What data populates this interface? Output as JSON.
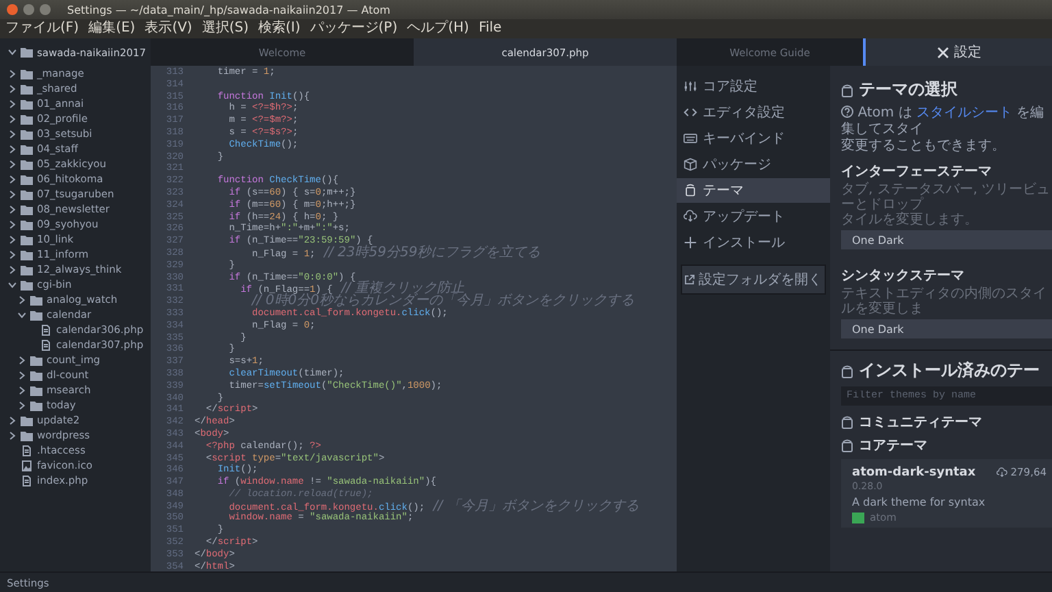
{
  "window": {
    "title": "Settings — ~/data_main/_hp/sawada-naikaiin2017 — Atom"
  },
  "menu": [
    "ファイル(F)",
    "編集(E)",
    "表示(V)",
    "選択(S)",
    "検索(I)",
    "パッケージ(P)",
    "ヘルプ(H)",
    "File"
  ],
  "sidebar": {
    "tree": {
      "name": "sawada-naikaiin2017",
      "kind": "folder",
      "expanded": true,
      "children": [
        {
          "name": "_manage",
          "kind": "folder",
          "expanded": false
        },
        {
          "name": "_shared",
          "kind": "folder",
          "expanded": false
        },
        {
          "name": "01_annai",
          "kind": "folder",
          "expanded": false
        },
        {
          "name": "02_profile",
          "kind": "folder",
          "expanded": false
        },
        {
          "name": "03_setsubi",
          "kind": "folder",
          "expanded": false
        },
        {
          "name": "04_staff",
          "kind": "folder",
          "expanded": false
        },
        {
          "name": "05_zakkicyou",
          "kind": "folder",
          "expanded": false
        },
        {
          "name": "06_hitokoma",
          "kind": "folder",
          "expanded": false
        },
        {
          "name": "07_tsugaruben",
          "kind": "folder",
          "expanded": false
        },
        {
          "name": "08_newsletter",
          "kind": "folder",
          "expanded": false
        },
        {
          "name": "09_syohyou",
          "kind": "folder",
          "expanded": false
        },
        {
          "name": "10_link",
          "kind": "folder",
          "expanded": false
        },
        {
          "name": "11_inform",
          "kind": "folder",
          "expanded": false
        },
        {
          "name": "12_always_think",
          "kind": "folder",
          "expanded": false
        },
        {
          "name": "cgi-bin",
          "kind": "folder",
          "expanded": true,
          "children": [
            {
              "name": "analog_watch",
              "kind": "folder",
              "expanded": false
            },
            {
              "name": "calendar",
              "kind": "folder",
              "expanded": true,
              "children": [
                {
                  "name": "calendar306.php",
                  "kind": "file"
                },
                {
                  "name": "calendar307.php",
                  "kind": "file"
                }
              ]
            },
            {
              "name": "count_img",
              "kind": "folder",
              "expanded": false
            },
            {
              "name": "dl-count",
              "kind": "folder",
              "expanded": false
            },
            {
              "name": "msearch",
              "kind": "folder",
              "expanded": false
            },
            {
              "name": "today",
              "kind": "folder",
              "expanded": false
            }
          ]
        },
        {
          "name": "update2",
          "kind": "folder",
          "expanded": false
        },
        {
          "name": "wordpress",
          "kind": "folder",
          "expanded": false
        },
        {
          "name": ".htaccess",
          "kind": "file"
        },
        {
          "name": "favicon.ico",
          "kind": "image"
        },
        {
          "name": "index.php",
          "kind": "file"
        }
      ]
    }
  },
  "editor_tabs": [
    {
      "label": "Welcome",
      "selected": false
    },
    {
      "label": "calendar307.php",
      "selected": true
    }
  ],
  "code": [
    {
      "number": "313",
      "tokens": [
        {
          "kind": "plain",
          "text": "    timer = "
        },
        {
          "kind": "number",
          "text": "1"
        },
        {
          "kind": "plain",
          "text": ";"
        }
      ]
    },
    {
      "number": "314"
    },
    {
      "number": "315",
      "tokens": [
        {
          "kind": "keyword",
          "text": "    function"
        },
        {
          "kind": "function",
          "text": " Init"
        },
        {
          "kind": "plain",
          "text": "(){"
        }
      ]
    },
    {
      "number": "316",
      "tokens": [
        {
          "kind": "plain",
          "text": "      h = "
        },
        {
          "kind": "php",
          "text": "<?=$h?>"
        },
        {
          "kind": "plain",
          "text": ";"
        }
      ]
    },
    {
      "number": "317",
      "tokens": [
        {
          "kind": "plain",
          "text": "      m = "
        },
        {
          "kind": "php",
          "text": "<?=$m?>"
        },
        {
          "kind": "plain",
          "text": ";"
        }
      ]
    },
    {
      "number": "318",
      "tokens": [
        {
          "kind": "plain",
          "text": "      s = "
        },
        {
          "kind": "php",
          "text": "<?=$s?>"
        },
        {
          "kind": "plain",
          "text": ";"
        }
      ]
    },
    {
      "number": "319",
      "tokens": [
        {
          "kind": "function",
          "text": "      CheckTime"
        },
        {
          "kind": "plain",
          "text": "();"
        }
      ]
    },
    {
      "number": "320",
      "tokens": [
        {
          "kind": "plain",
          "text": "    }"
        }
      ]
    },
    {
      "number": "321"
    },
    {
      "number": "322",
      "tokens": [
        {
          "kind": "keyword",
          "text": "    function"
        },
        {
          "kind": "function",
          "text": " CheckTime"
        },
        {
          "kind": "plain",
          "text": "(){"
        }
      ]
    },
    {
      "number": "323",
      "tokens": [
        {
          "kind": "keyword",
          "text": "      if"
        },
        {
          "kind": "plain",
          "text": " (s=="
        },
        {
          "kind": "number",
          "text": "60"
        },
        {
          "kind": "plain",
          "text": ") { s="
        },
        {
          "kind": "number",
          "text": "0"
        },
        {
          "kind": "plain",
          "text": ";m++;}"
        }
      ]
    },
    {
      "number": "324",
      "tokens": [
        {
          "kind": "keyword",
          "text": "      if"
        },
        {
          "kind": "plain",
          "text": " (m=="
        },
        {
          "kind": "number",
          "text": "60"
        },
        {
          "kind": "plain",
          "text": ") { m="
        },
        {
          "kind": "number",
          "text": "0"
        },
        {
          "kind": "plain",
          "text": ";h++;}"
        }
      ]
    },
    {
      "number": "325",
      "tokens": [
        {
          "kind": "keyword",
          "text": "      if"
        },
        {
          "kind": "plain",
          "text": " (h=="
        },
        {
          "kind": "number",
          "text": "24"
        },
        {
          "kind": "plain",
          "text": ") { h="
        },
        {
          "kind": "number",
          "text": "0"
        },
        {
          "kind": "plain",
          "text": "; }"
        }
      ]
    },
    {
      "number": "326",
      "tokens": [
        {
          "kind": "plain",
          "text": "      n_Time=h+"
        },
        {
          "kind": "string",
          "text": "\":\""
        },
        {
          "kind": "plain",
          "text": "+m+"
        },
        {
          "kind": "string",
          "text": "\":\""
        },
        {
          "kind": "plain",
          "text": "+s;"
        }
      ]
    },
    {
      "number": "327",
      "tokens": [
        {
          "kind": "keyword",
          "text": "      if"
        },
        {
          "kind": "plain",
          "text": " (n_Time=="
        },
        {
          "kind": "string",
          "text": "\"23:59:59\""
        },
        {
          "kind": "plain",
          "text": ") {"
        }
      ]
    },
    {
      "number": "328",
      "tokens": [
        {
          "kind": "plain",
          "text": "          n_Flag = "
        },
        {
          "kind": "number",
          "text": "1"
        },
        {
          "kind": "plain",
          "text": ";"
        },
        {
          "kind": "comment",
          "text": "  // 23時59分59秒にフラグを立てる"
        }
      ]
    },
    {
      "number": "329",
      "tokens": [
        {
          "kind": "plain",
          "text": "      }"
        }
      ]
    },
    {
      "number": "330",
      "tokens": [
        {
          "kind": "keyword",
          "text": "      if"
        },
        {
          "kind": "plain",
          "text": " (n_Time=="
        },
        {
          "kind": "string",
          "text": "\"0:0:0\""
        },
        {
          "kind": "plain",
          "text": ") {"
        }
      ]
    },
    {
      "number": "331",
      "tokens": [
        {
          "kind": "keyword",
          "text": "        if"
        },
        {
          "kind": "plain",
          "text": " (n_Flag=="
        },
        {
          "kind": "number",
          "text": "1"
        },
        {
          "kind": "plain",
          "text": ") {"
        },
        {
          "kind": "comment",
          "text": "  // 重複クリック防止"
        }
      ]
    },
    {
      "number": "332",
      "tokens": [
        {
          "kind": "comment",
          "text": "          // 0時0分0秒ならカレンダーの「今月」ボタンをクリックする"
        }
      ]
    },
    {
      "number": "333",
      "tokens": [
        {
          "kind": "variable",
          "text": "          document.cal_form.kongetu."
        },
        {
          "kind": "function",
          "text": "click"
        },
        {
          "kind": "plain",
          "text": "();"
        }
      ]
    },
    {
      "number": "334",
      "tokens": [
        {
          "kind": "plain",
          "text": "          n_Flag = "
        },
        {
          "kind": "number",
          "text": "0"
        },
        {
          "kind": "plain",
          "text": ";"
        }
      ]
    },
    {
      "number": "335",
      "tokens": [
        {
          "kind": "plain",
          "text": "        }"
        }
      ]
    },
    {
      "number": "336",
      "tokens": [
        {
          "kind": "plain",
          "text": "      }"
        }
      ]
    },
    {
      "number": "337",
      "tokens": [
        {
          "kind": "plain",
          "text": "      s=s+"
        },
        {
          "kind": "number",
          "text": "1"
        },
        {
          "kind": "plain",
          "text": ";"
        }
      ]
    },
    {
      "number": "338",
      "tokens": [
        {
          "kind": "function",
          "text": "      clearTimeout"
        },
        {
          "kind": "plain",
          "text": "(timer);"
        }
      ]
    },
    {
      "number": "339",
      "tokens": [
        {
          "kind": "plain",
          "text": "      timer="
        },
        {
          "kind": "function",
          "text": "setTimeout"
        },
        {
          "kind": "plain",
          "text": "("
        },
        {
          "kind": "string",
          "text": "\"CheckTime()\""
        },
        {
          "kind": "plain",
          "text": ","
        },
        {
          "kind": "number",
          "text": "1000"
        },
        {
          "kind": "plain",
          "text": ");"
        }
      ]
    },
    {
      "number": "340",
      "tokens": [
        {
          "kind": "plain",
          "text": "    }"
        }
      ]
    },
    {
      "number": "341",
      "tokens": [
        {
          "kind": "plain",
          "text": "  </"
        },
        {
          "kind": "tag",
          "text": "script"
        },
        {
          "kind": "plain",
          "text": ">"
        }
      ]
    },
    {
      "number": "342",
      "tokens": [
        {
          "kind": "plain",
          "text": "</"
        },
        {
          "kind": "tag",
          "text": "head"
        },
        {
          "kind": "plain",
          "text": ">"
        }
      ]
    },
    {
      "number": "343",
      "tokens": [
        {
          "kind": "plain",
          "text": "<"
        },
        {
          "kind": "tag",
          "text": "body"
        },
        {
          "kind": "plain",
          "text": ">"
        }
      ]
    },
    {
      "number": "344",
      "tokens": [
        {
          "kind": "php",
          "text": "  <?php"
        },
        {
          "kind": "plain",
          "text": " calendar(); "
        },
        {
          "kind": "php",
          "text": "?>"
        }
      ]
    },
    {
      "number": "345",
      "tokens": [
        {
          "kind": "plain",
          "text": "  <"
        },
        {
          "kind": "tag",
          "text": "script"
        },
        {
          "kind": "attr",
          "text": " type"
        },
        {
          "kind": "plain",
          "text": "="
        },
        {
          "kind": "string",
          "text": "\"text/javascript\""
        },
        {
          "kind": "plain",
          "text": ">"
        }
      ]
    },
    {
      "number": "346",
      "tokens": [
        {
          "kind": "function",
          "text": "    Init"
        },
        {
          "kind": "plain",
          "text": "();"
        }
      ]
    },
    {
      "number": "347",
      "tokens": [
        {
          "kind": "keyword",
          "text": "    if"
        },
        {
          "kind": "plain",
          "text": " ("
        },
        {
          "kind": "variable",
          "text": "window.name"
        },
        {
          "kind": "plain",
          "text": " != "
        },
        {
          "kind": "string",
          "text": "\"sawada-naikaiin\""
        },
        {
          "kind": "plain",
          "text": "){"
        }
      ]
    },
    {
      "number": "348",
      "tokens": [
        {
          "kind": "comment",
          "text": "      // location.reload(true);"
        }
      ]
    },
    {
      "number": "349",
      "tokens": [
        {
          "kind": "variable",
          "text": "      document.cal_form.kongetu."
        },
        {
          "kind": "function",
          "text": "click"
        },
        {
          "kind": "plain",
          "text": "();"
        },
        {
          "kind": "comment",
          "text": "  // 「今月」ボタンをクリックする"
        }
      ]
    },
    {
      "number": "350",
      "tokens": [
        {
          "kind": "variable",
          "text": "      window.name"
        },
        {
          "kind": "plain",
          "text": " = "
        },
        {
          "kind": "string",
          "text": "\"sawada-naikaiin\""
        },
        {
          "kind": "plain",
          "text": ";"
        }
      ]
    },
    {
      "number": "351",
      "tokens": [
        {
          "kind": "plain",
          "text": "    }"
        }
      ]
    },
    {
      "number": "352",
      "tokens": [
        {
          "kind": "plain",
          "text": "  </"
        },
        {
          "kind": "tag",
          "text": "script"
        },
        {
          "kind": "plain",
          "text": ">"
        }
      ]
    },
    {
      "number": "353",
      "tokens": [
        {
          "kind": "plain",
          "text": "</"
        },
        {
          "kind": "tag",
          "text": "body"
        },
        {
          "kind": "plain",
          "text": ">"
        }
      ]
    },
    {
      "number": "354",
      "tokens": [
        {
          "kind": "plain",
          "text": "</"
        },
        {
          "kind": "tag",
          "text": "html"
        },
        {
          "kind": "plain",
          "text": ">"
        }
      ]
    }
  ],
  "settings_tabs": [
    {
      "label": "Welcome Guide",
      "kind": "plain",
      "selected": false
    },
    {
      "label": "設定",
      "kind": "settings",
      "selected": true
    }
  ],
  "settings": {
    "nav": [
      {
        "label": "コア設定",
        "selected": false
      },
      {
        "label": "エディタ設定",
        "selected": false
      },
      {
        "label": "キーバインド",
        "selected": false
      },
      {
        "label": "パッケージ",
        "selected": false
      },
      {
        "label": "テーマ",
        "selected": true
      },
      {
        "label": "アップデート",
        "selected": false
      },
      {
        "label": "インストール",
        "selected": false
      }
    ],
    "open_folder_button": "設定フォルダを開く",
    "theme_section": {
      "heading": "テーマの選択",
      "intro_before": "Atom は",
      "intro_link": "スタイルシート",
      "intro_after": "を編集してスタイ",
      "intro_continued": "変更することもできます。",
      "fields": [
        {
          "label": "インターフェーステーマ",
          "description": "タブ, ステータスバー, ツリービューとドロップ",
          "description_continued": "タイルを変更します。",
          "value": "One Dark"
        },
        {
          "label": "シンタックステーマ",
          "description": "テキストエディタの内側のスタイルを変更しま",
          "value": "One Dark"
        }
      ]
    },
    "installed_section": {
      "heading": "インストール済みのテー",
      "filter_placeholder": "Filter themes by name"
    },
    "community_heading": "コミュニティテーマ",
    "core_heading": "コアテーマ",
    "card": {
      "name": "atom-dark-syntax",
      "version": "0.28.0",
      "downloads": "279,64",
      "description": "A dark theme for syntax",
      "author": "atom"
    }
  },
  "status_bar": {
    "text": "Settings"
  }
}
